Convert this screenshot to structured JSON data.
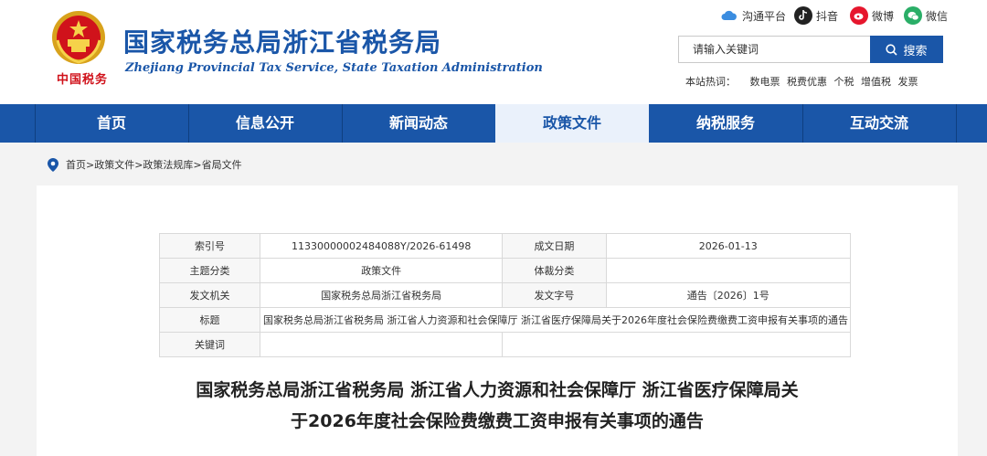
{
  "header": {
    "title": "国家税务总局浙江省税务局",
    "subtitle": "Zhejiang Provincial Tax Service, State Taxation Administration",
    "slogan": "中国税务"
  },
  "social": [
    {
      "label": "沟通平台",
      "icon": "cloud-icon",
      "color": "#3b8de0"
    },
    {
      "label": "抖音",
      "icon": "tiktok-icon",
      "color": "#222222"
    },
    {
      "label": "微博",
      "icon": "weibo-icon",
      "color": "#e6162d"
    },
    {
      "label": "微信",
      "icon": "wechat-icon",
      "color": "#2aae67"
    }
  ],
  "search": {
    "placeholder": "请输入关键词",
    "button_label": "搜索"
  },
  "hotwords": {
    "label": "本站热词：",
    "items": [
      "数电票",
      "税费优惠",
      "个税",
      "增值税",
      "发票"
    ]
  },
  "nav": {
    "items": [
      "首页",
      "信息公开",
      "新闻动态",
      "政策文件",
      "纳税服务",
      "互动交流"
    ],
    "active": "政策文件"
  },
  "breadcrumb": "首页>政策文件>政策法规库>省局文件",
  "meta_table": {
    "index_no_label": "索引号",
    "index_no": "11330000002484088Y/2026-61498",
    "date_label": "成文日期",
    "date": "2026-01-13",
    "category_label": "主题分类",
    "category": "政策文件",
    "genre_label": "体裁分类",
    "genre": "",
    "issuer_label": "发文机关",
    "issuer": "国家税务总局浙江省税务局",
    "doc_no_label": "发文字号",
    "doc_no": "通告〔2026〕1号",
    "title_label": "标题",
    "title": "国家税务总局浙江省税务局 浙江省人力资源和社会保障厅 浙江省医疗保障局关于2026年度社会保险费缴费工资申报有关事项的通告",
    "keywords_label": "关键词",
    "keywords": ""
  },
  "document": {
    "title_line1": "国家税务总局浙江省税务局 浙江省人力资源和社会保障厅 浙江省医疗保障局关",
    "title_line2": "于2026年度社会保险费缴费工资申报有关事项的通告"
  },
  "colors": {
    "brand": "#1a56a8",
    "red": "#d0121b"
  }
}
